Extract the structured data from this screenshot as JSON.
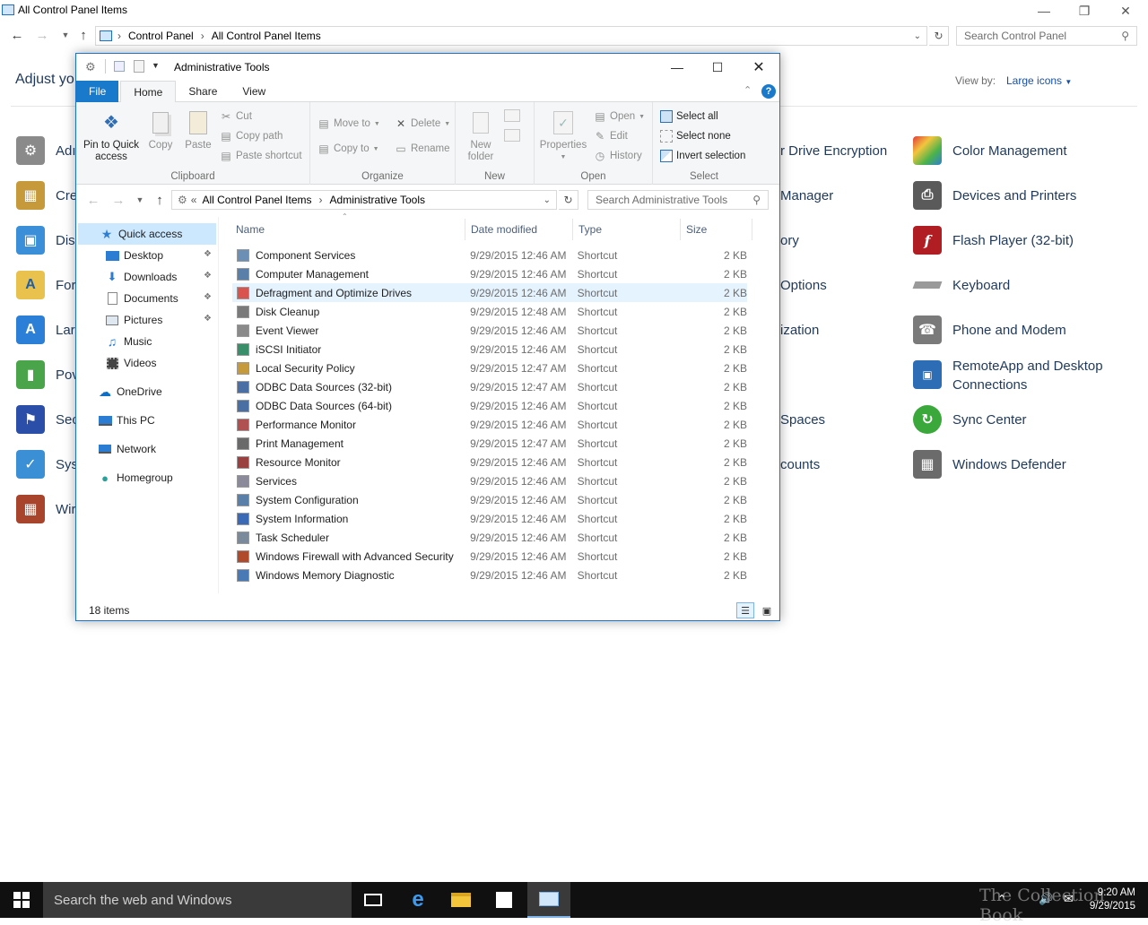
{
  "control_panel": {
    "window_title": "All Control Panel Items",
    "breadcrumb": [
      "Control Panel",
      "All Control Panel Items"
    ],
    "search_placeholder": "Search Control Panel",
    "heading": "Adjust yo",
    "view_by_label": "View by:",
    "view_by_value": "Large icons",
    "left_items": [
      "Adı",
      "Cre",
      "Dis",
      "For",
      "Lar",
      "Pov",
      "Sec",
      "Sys",
      "Wir"
    ],
    "middle_items": [
      "r Drive Encryption",
      "Manager",
      "ory",
      "Options",
      "ization",
      "",
      "Spaces",
      "counts"
    ],
    "right_items": [
      {
        "label": "Color Management",
        "icon": "color-management-icon",
        "color": "#2f7fd1"
      },
      {
        "label": "Devices and Printers",
        "icon": "printer-icon",
        "color": "#4a4a4a"
      },
      {
        "label": "Flash Player (32-bit)",
        "icon": "flash-icon",
        "color": "#b01e23"
      },
      {
        "label": "Keyboard",
        "icon": "keyboard-icon",
        "color": "#9a9a9a"
      },
      {
        "label": "Phone and Modem",
        "icon": "phone-icon",
        "color": "#7a7a7a"
      },
      {
        "label": "RemoteApp and Desktop",
        "label2": "Connections",
        "icon": "remoteapp-icon",
        "color": "#2d6db5"
      },
      {
        "label": "Sync Center",
        "icon": "sync-icon",
        "color": "#3aa83a"
      },
      {
        "label": "Windows Defender",
        "icon": "defender-icon",
        "color": "#6b6b6b"
      }
    ]
  },
  "explorer": {
    "title": "Administrative Tools",
    "tabs": [
      "File",
      "Home",
      "Share",
      "View"
    ],
    "ribbon": {
      "clipboard": {
        "label": "Clipboard",
        "pin": "Pin to Quick",
        "pin2": "access",
        "copy": "Copy",
        "paste": "Paste",
        "cut": "Cut",
        "copy_path": "Copy path",
        "paste_shortcut": "Paste shortcut"
      },
      "organize": {
        "label": "Organize",
        "move_to": "Move to",
        "copy_to": "Copy to",
        "delete": "Delete",
        "rename": "Rename"
      },
      "new": {
        "label": "New",
        "new_folder": "New",
        "new_folder2": "folder"
      },
      "open": {
        "label": "Open",
        "properties": "Properties",
        "open": "Open",
        "edit": "Edit",
        "history": "History"
      },
      "select": {
        "label": "Select",
        "select_all": "Select all",
        "select_none": "Select none",
        "invert": "Invert selection"
      }
    },
    "address": {
      "prefix": "«",
      "crumbs": [
        "All Control Panel Items",
        "Administrative Tools"
      ]
    },
    "search_placeholder": "Search Administrative Tools",
    "nav": {
      "quick_access": "Quick access",
      "items": [
        "Desktop",
        "Downloads",
        "Documents",
        "Pictures",
        "Music",
        "Videos"
      ],
      "onedrive": "OneDrive",
      "this_pc": "This PC",
      "network": "Network",
      "homegroup": "Homegroup"
    },
    "columns": [
      "Name",
      "Date modified",
      "Type",
      "Size"
    ],
    "files": [
      {
        "name": "Component Services",
        "date": "9/29/2015 12:46 AM",
        "type": "Shortcut",
        "size": "2 KB"
      },
      {
        "name": "Computer Management",
        "date": "9/29/2015 12:46 AM",
        "type": "Shortcut",
        "size": "2 KB"
      },
      {
        "name": "Defragment and Optimize Drives",
        "date": "9/29/2015 12:46 AM",
        "type": "Shortcut",
        "size": "2 KB"
      },
      {
        "name": "Disk Cleanup",
        "date": "9/29/2015 12:48 AM",
        "type": "Shortcut",
        "size": "2 KB"
      },
      {
        "name": "Event Viewer",
        "date": "9/29/2015 12:46 AM",
        "type": "Shortcut",
        "size": "2 KB"
      },
      {
        "name": "iSCSI Initiator",
        "date": "9/29/2015 12:46 AM",
        "type": "Shortcut",
        "size": "2 KB"
      },
      {
        "name": "Local Security Policy",
        "date": "9/29/2015 12:47 AM",
        "type": "Shortcut",
        "size": "2 KB"
      },
      {
        "name": "ODBC Data Sources (32-bit)",
        "date": "9/29/2015 12:47 AM",
        "type": "Shortcut",
        "size": "2 KB"
      },
      {
        "name": "ODBC Data Sources (64-bit)",
        "date": "9/29/2015 12:46 AM",
        "type": "Shortcut",
        "size": "2 KB"
      },
      {
        "name": "Performance Monitor",
        "date": "9/29/2015 12:46 AM",
        "type": "Shortcut",
        "size": "2 KB"
      },
      {
        "name": "Print Management",
        "date": "9/29/2015 12:47 AM",
        "type": "Shortcut",
        "size": "2 KB"
      },
      {
        "name": "Resource Monitor",
        "date": "9/29/2015 12:46 AM",
        "type": "Shortcut",
        "size": "2 KB"
      },
      {
        "name": "Services",
        "date": "9/29/2015 12:46 AM",
        "type": "Shortcut",
        "size": "2 KB"
      },
      {
        "name": "System Configuration",
        "date": "9/29/2015 12:46 AM",
        "type": "Shortcut",
        "size": "2 KB"
      },
      {
        "name": "System Information",
        "date": "9/29/2015 12:46 AM",
        "type": "Shortcut",
        "size": "2 KB"
      },
      {
        "name": "Task Scheduler",
        "date": "9/29/2015 12:46 AM",
        "type": "Shortcut",
        "size": "2 KB"
      },
      {
        "name": "Windows Firewall with Advanced Security",
        "date": "9/29/2015 12:46 AM",
        "type": "Shortcut",
        "size": "2 KB"
      },
      {
        "name": "Windows Memory Diagnostic",
        "date": "9/29/2015 12:46 AM",
        "type": "Shortcut",
        "size": "2 KB"
      }
    ],
    "selected_index": 2,
    "status": "18 items"
  },
  "taskbar": {
    "search_placeholder": "Search the web and Windows",
    "time": "9:20 AM",
    "date": "9/29/2015",
    "watermark": "The Collection Book"
  }
}
